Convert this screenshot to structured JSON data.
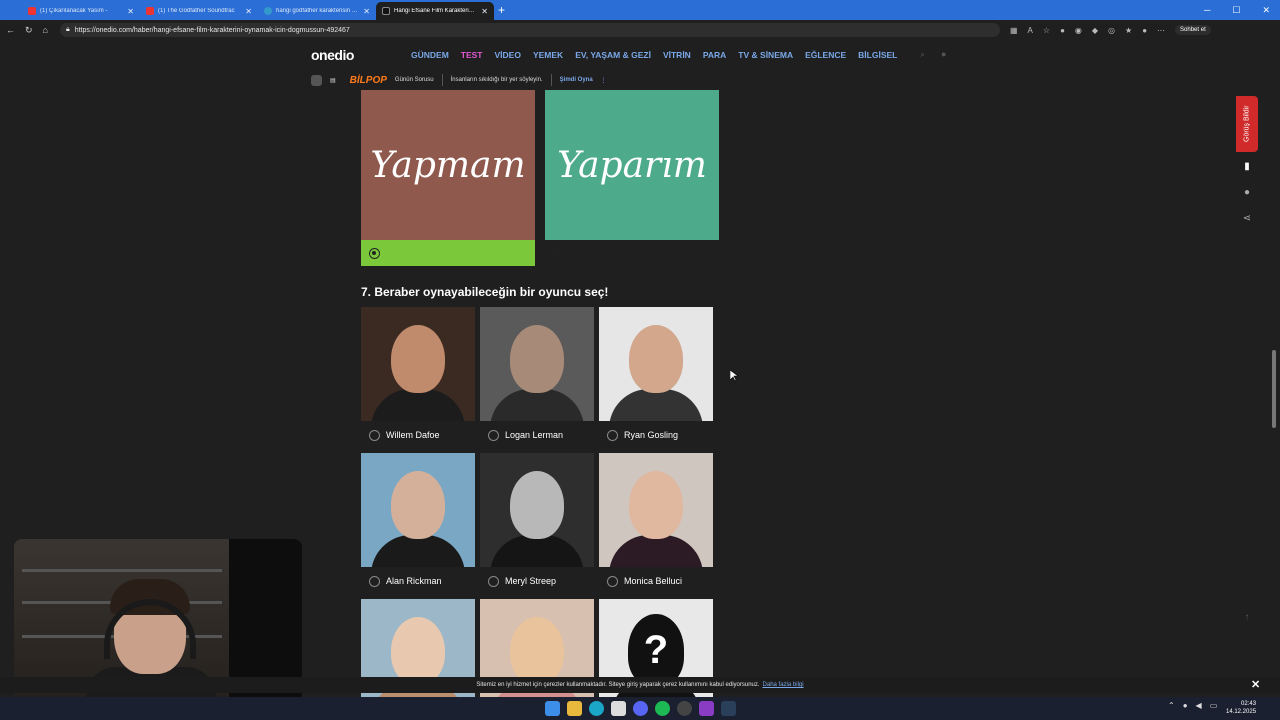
{
  "browser": {
    "tabs": [
      {
        "title": "(1) Çıkarılanacak Yasım -",
        "active": false,
        "color": "#e33"
      },
      {
        "title": "(1) The Godfather Soundtrac",
        "active": false,
        "color": "#e33"
      },
      {
        "title": "hangi godfather karakterisin - Goo",
        "active": false,
        "color": "#39c"
      },
      {
        "title": "Hangi Efsane Film Karakterini Oyn",
        "active": true,
        "color": "#111"
      }
    ],
    "url": "https://onedio.com/haber/hangi-efsane-film-karakterini-oynamak-icin-dogmussun-492467",
    "chat_label": "Sohbet et"
  },
  "site": {
    "logo": "onedio",
    "nav": [
      "GÜNDEM",
      "TEST",
      "VİDEO",
      "YEMEK",
      "EV, YAŞAM & GEZİ",
      "VİTRİN",
      "PARA",
      "TV & SİNEMA",
      "EĞLENCE",
      "BİLGİSEL"
    ],
    "sub": {
      "bilpop": "BİLPOP",
      "daily": "Günün Sorusu",
      "daily_text": "İnsanların sıkıldığı bir yer söyleyin.",
      "play": "Şimdi Oyna"
    }
  },
  "previous_question": {
    "left_option": "Yapmam",
    "right_option": "Yaparım",
    "selected": "left"
  },
  "question": {
    "title": "7. Beraber oynayabileceğin bir oyuncu seç!",
    "options": [
      {
        "name": "Willem Dafoe",
        "bg": "#3a2a22",
        "skin": "#c08a6c",
        "cloth": "#1c1c1c"
      },
      {
        "name": "Logan Lerman",
        "bg": "#5a5a5a",
        "skin": "#a88a78",
        "cloth": "#2a2a2a"
      },
      {
        "name": "Ryan Gosling",
        "bg": "#e6e6e6",
        "skin": "#d2a78c",
        "cloth": "#333333"
      },
      {
        "name": "Alan Rickman",
        "bg": "#7aa7c4",
        "skin": "#d4b09a",
        "cloth": "#1a1a1a"
      },
      {
        "name": "Meryl Streep",
        "bg": "#2e2e2e",
        "skin": "#b8b8b8",
        "cloth": "#151515"
      },
      {
        "name": "Monica Belluci",
        "bg": "#cfc6c0",
        "skin": "#e0b8a0",
        "cloth": "#2c1a24"
      },
      {
        "name": "",
        "bg": "#9cb8c8",
        "skin": "#e8c9b0",
        "cloth": "#b89070"
      },
      {
        "name": "",
        "bg": "#d8c0b0",
        "skin": "#e8c39c",
        "cloth": "#d49090"
      },
      {
        "name": "",
        "bg": "#e8e8e8",
        "skin": "#111111",
        "cloth": "#111111"
      }
    ]
  },
  "feedback_label": "Görüş Bildir",
  "cookie": {
    "text": "Sitemiz en iyi hizmet için çerezler kullanmaktadır. Siteye giriş yaparak çerez kullanımını kabul ediyorsunuz.",
    "link": "Daha fazla bilgi"
  },
  "clock": {
    "time": "02:43",
    "date": "14.12.2025"
  }
}
